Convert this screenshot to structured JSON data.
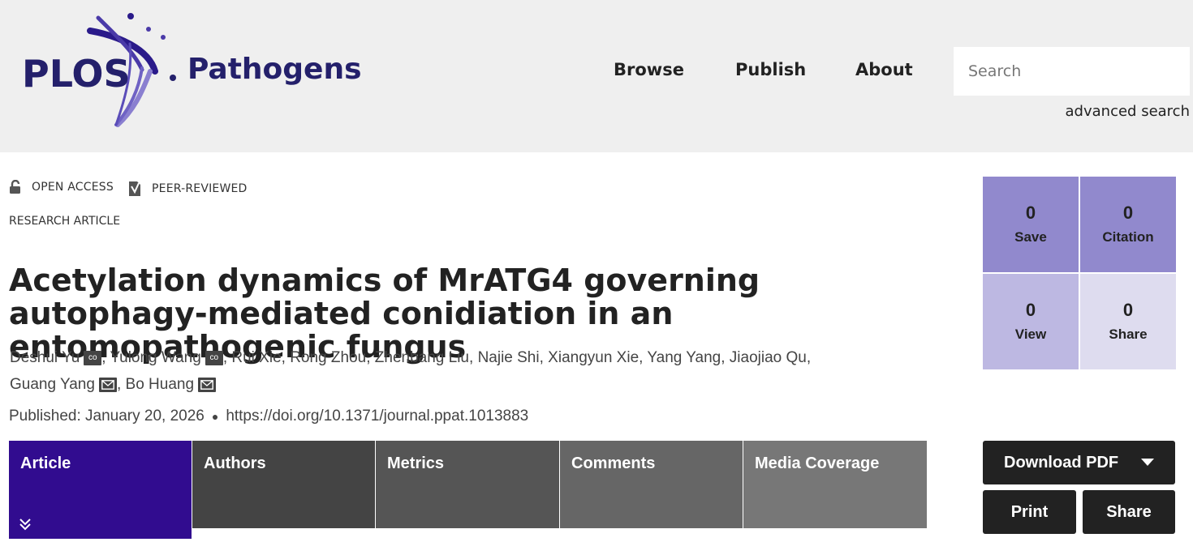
{
  "header": {
    "logo_plos": "PLOS",
    "logo_journal": "Pathogens",
    "nav": [
      "Browse",
      "Publish",
      "About"
    ],
    "search_placeholder": "Search",
    "advanced_search": "advanced search"
  },
  "badges": {
    "open_access": "OPEN ACCESS",
    "peer_reviewed": "PEER-REVIEWED"
  },
  "article_type": "RESEARCH ARTICLE",
  "title": "Acetylation dynamics of MrATG4 governing autophagy-mediated conidiation in an entomopathogenic fungus",
  "authors": [
    {
      "name": "Deshui Yu",
      "mark": "co"
    },
    {
      "name": "Yulong Wang",
      "mark": "co"
    },
    {
      "name": "Rui Xie",
      "mark": ""
    },
    {
      "name": "Rong Zhou",
      "mark": ""
    },
    {
      "name": "Zhenbang Liu",
      "mark": ""
    },
    {
      "name": "Najie Shi",
      "mark": ""
    },
    {
      "name": "Xiangyun Xie",
      "mark": ""
    },
    {
      "name": "Yang Yang",
      "mark": ""
    },
    {
      "name": "Jiaojiao Qu",
      "mark": ""
    },
    {
      "name": "Guang Yang",
      "mark": "mail"
    },
    {
      "name": "Bo Huang",
      "mark": "mail"
    }
  ],
  "co_label": "co",
  "published": {
    "label": "Published: January 20, 2026",
    "doi": "https://doi.org/10.1371/journal.ppat.1013883"
  },
  "tabs": [
    {
      "label": "Article",
      "color": "#310c8f"
    },
    {
      "label": "Authors",
      "color": "#444444"
    },
    {
      "label": "Metrics",
      "color": "#555555"
    },
    {
      "label": "Comments",
      "color": "#666666"
    },
    {
      "label": "Media Coverage",
      "color": "#777777"
    }
  ],
  "metrics": [
    {
      "value": "0",
      "label": "Save",
      "color": "#9189cd"
    },
    {
      "value": "0",
      "label": "Citation",
      "color": "#9189cd"
    },
    {
      "value": "0",
      "label": "View",
      "color": "#bdb8e2"
    },
    {
      "value": "0",
      "label": "Share",
      "color": "#dedcef"
    }
  ],
  "actions": {
    "download_pdf": "Download PDF",
    "print": "Print",
    "share": "Share"
  },
  "colors": {
    "brand": "#24206b",
    "accent": "#310c8f",
    "header_bg": "#efefef"
  }
}
